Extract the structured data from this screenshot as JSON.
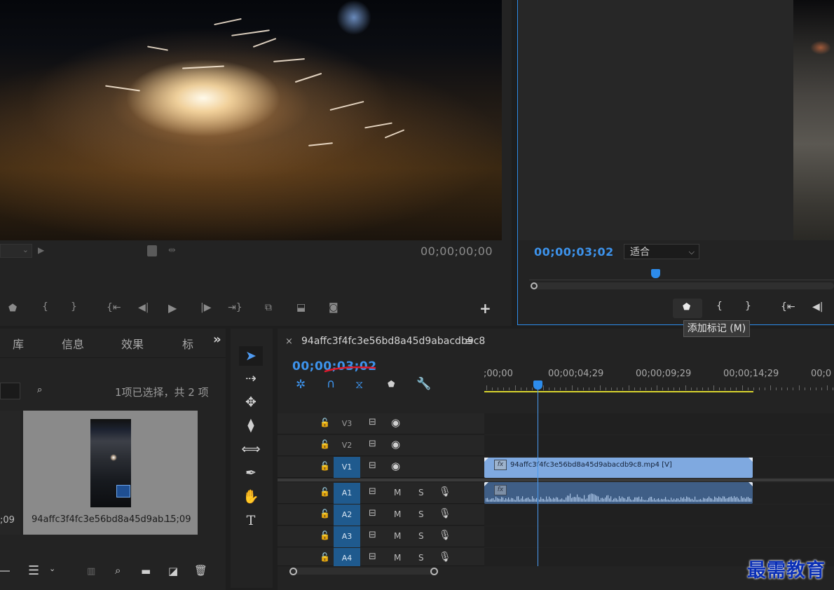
{
  "source_monitor": {
    "timecode": "00;00;00;00",
    "controls": [
      "marker",
      "mark-in",
      "mark-out",
      "go-to-in",
      "step-back",
      "play",
      "step-forward",
      "go-to-out",
      "insert",
      "overwrite",
      "export-frame",
      "add"
    ]
  },
  "program_monitor": {
    "timecode": "00;00;03;02",
    "fit_select": "适合",
    "tooltip": "添加标记 (M)"
  },
  "project_panel": {
    "tabs": [
      "库",
      "信息",
      "效果",
      "标"
    ],
    "overflow": "»",
    "selection_status": "1项已选择，共 2 项",
    "left_item_duration": ";09",
    "item": {
      "name": "94affc3f4fc3e56bd8a45d9ab...",
      "duration": "15;09"
    }
  },
  "timeline": {
    "sequence_name": "94affc3f4fc3e56bd8a45d9abacdb9c8",
    "menu_icon": "≡",
    "close": "×",
    "timecode": "00;00;03;02",
    "ruler_labels": [
      ";00;00",
      "00;00;04;29",
      "00;00;09;29",
      "00;00;14;29",
      "00;0"
    ],
    "tracks": [
      {
        "name": "V3",
        "kind": "video",
        "targeted": false
      },
      {
        "name": "V2",
        "kind": "video",
        "targeted": false
      },
      {
        "name": "V1",
        "kind": "video",
        "targeted": true
      },
      {
        "name": "A1",
        "kind": "audio",
        "targeted": true,
        "m": "M",
        "s": "S"
      },
      {
        "name": "A2",
        "kind": "audio",
        "targeted": true,
        "m": "M",
        "s": "S"
      },
      {
        "name": "A3",
        "kind": "audio",
        "targeted": true,
        "m": "M",
        "s": "S"
      },
      {
        "name": "A4",
        "kind": "audio",
        "targeted": true,
        "m": "M",
        "s": "S"
      }
    ],
    "video_clip_label": "94affc3f4fc3e56bd8a45d9abacdb9c8.mp4 [V]",
    "fx_badge": "fx"
  },
  "watermark": "最需教育",
  "colors": {
    "accent_blue": "#2d8ceb",
    "video_clip": "#7fa9e0",
    "audio_clip": "#3f5e86",
    "work_area": "#d7d32e",
    "annotation_red": "#e0192a"
  }
}
